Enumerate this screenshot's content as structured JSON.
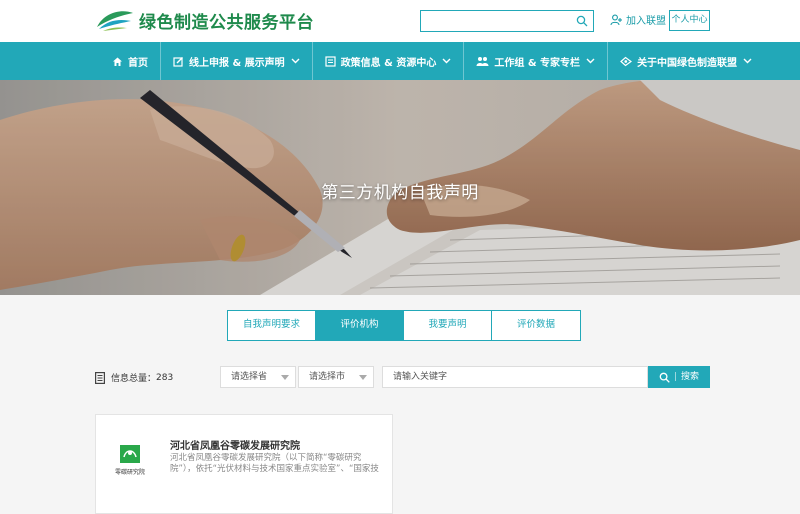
{
  "header": {
    "site_title": "绿色制造公共服务平台",
    "join_label": "加入联盟",
    "personal_center_label": "个人中心"
  },
  "nav": {
    "items": [
      {
        "label": "首页",
        "icon": "home-icon",
        "has_dropdown": false
      },
      {
        "label": "线上申报 & 展示声明",
        "icon": "edit-icon",
        "has_dropdown": true
      },
      {
        "label": "政策信息 & 资源中心",
        "icon": "document-icon",
        "has_dropdown": true
      },
      {
        "label": "工作组 & 专家专栏",
        "icon": "group-icon",
        "has_dropdown": true
      },
      {
        "label": "关于中国绿色制造联盟",
        "icon": "link-icon",
        "has_dropdown": true
      }
    ]
  },
  "banner": {
    "title": "第三方机构自我声明"
  },
  "tabs": [
    {
      "label": "自我声明要求",
      "active": false
    },
    {
      "label": "评价机构",
      "active": true
    },
    {
      "label": "我要声明",
      "active": false
    },
    {
      "label": "评价数据",
      "active": false
    }
  ],
  "filters": {
    "count_label": "信息总量：",
    "count_value": "283",
    "province_placeholder": "请选择省",
    "city_placeholder": "请选择市",
    "keyword_placeholder": "请输入关键字",
    "search_label": "搜索"
  },
  "results": [
    {
      "logo_label": "零碳研究院",
      "title": "河北省凤凰谷零碳发展研究院",
      "description": "河北省凤凰谷零碳发展研究院（以下简称“零碳研究院”），依托“光伏材料与技术国家重点实验室”、“国家技"
    }
  ],
  "colors": {
    "primary": "#22a8b8",
    "brand_green": "#1f8a4c"
  }
}
